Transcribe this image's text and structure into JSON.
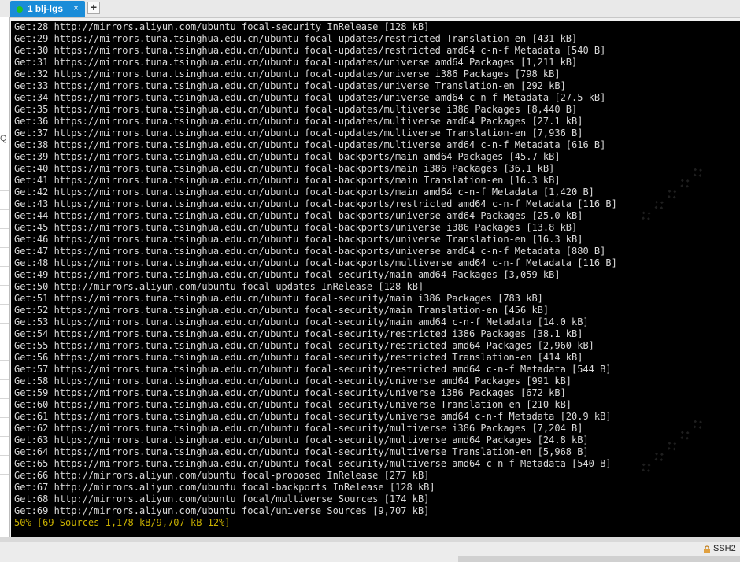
{
  "tab": {
    "number": "1",
    "name": "blj-lgs",
    "close": "×",
    "add": "+"
  },
  "sidebar": {
    "search_glyph": "Q"
  },
  "terminal": {
    "lines": [
      "Get:28 http://mirrors.aliyun.com/ubuntu focal-security InRelease [128 kB]",
      "Get:29 https://mirrors.tuna.tsinghua.edu.cn/ubuntu focal-updates/restricted Translation-en [431 kB]",
      "Get:30 https://mirrors.tuna.tsinghua.edu.cn/ubuntu focal-updates/restricted amd64 c-n-f Metadata [540 B]",
      "Get:31 https://mirrors.tuna.tsinghua.edu.cn/ubuntu focal-updates/universe amd64 Packages [1,211 kB]",
      "Get:32 https://mirrors.tuna.tsinghua.edu.cn/ubuntu focal-updates/universe i386 Packages [798 kB]",
      "Get:33 https://mirrors.tuna.tsinghua.edu.cn/ubuntu focal-updates/universe Translation-en [292 kB]",
      "Get:34 https://mirrors.tuna.tsinghua.edu.cn/ubuntu focal-updates/universe amd64 c-n-f Metadata [27.5 kB]",
      "Get:35 https://mirrors.tuna.tsinghua.edu.cn/ubuntu focal-updates/multiverse i386 Packages [8,440 B]",
      "Get:36 https://mirrors.tuna.tsinghua.edu.cn/ubuntu focal-updates/multiverse amd64 Packages [27.1 kB]",
      "Get:37 https://mirrors.tuna.tsinghua.edu.cn/ubuntu focal-updates/multiverse Translation-en [7,936 B]",
      "Get:38 https://mirrors.tuna.tsinghua.edu.cn/ubuntu focal-updates/multiverse amd64 c-n-f Metadata [616 B]",
      "Get:39 https://mirrors.tuna.tsinghua.edu.cn/ubuntu focal-backports/main amd64 Packages [45.7 kB]",
      "Get:40 https://mirrors.tuna.tsinghua.edu.cn/ubuntu focal-backports/main i386 Packages [36.1 kB]",
      "Get:41 https://mirrors.tuna.tsinghua.edu.cn/ubuntu focal-backports/main Translation-en [16.3 kB]",
      "Get:42 https://mirrors.tuna.tsinghua.edu.cn/ubuntu focal-backports/main amd64 c-n-f Metadata [1,420 B]",
      "Get:43 https://mirrors.tuna.tsinghua.edu.cn/ubuntu focal-backports/restricted amd64 c-n-f Metadata [116 B]",
      "Get:44 https://mirrors.tuna.tsinghua.edu.cn/ubuntu focal-backports/universe amd64 Packages [25.0 kB]",
      "Get:45 https://mirrors.tuna.tsinghua.edu.cn/ubuntu focal-backports/universe i386 Packages [13.8 kB]",
      "Get:46 https://mirrors.tuna.tsinghua.edu.cn/ubuntu focal-backports/universe Translation-en [16.3 kB]",
      "Get:47 https://mirrors.tuna.tsinghua.edu.cn/ubuntu focal-backports/universe amd64 c-n-f Metadata [880 B]",
      "Get:48 https://mirrors.tuna.tsinghua.edu.cn/ubuntu focal-backports/multiverse amd64 c-n-f Metadata [116 B]",
      "Get:49 https://mirrors.tuna.tsinghua.edu.cn/ubuntu focal-security/main amd64 Packages [3,059 kB]",
      "Get:50 http://mirrors.aliyun.com/ubuntu focal-updates InRelease [128 kB]",
      "Get:51 https://mirrors.tuna.tsinghua.edu.cn/ubuntu focal-security/main i386 Packages [783 kB]",
      "Get:52 https://mirrors.tuna.tsinghua.edu.cn/ubuntu focal-security/main Translation-en [456 kB]",
      "Get:53 https://mirrors.tuna.tsinghua.edu.cn/ubuntu focal-security/main amd64 c-n-f Metadata [14.0 kB]",
      "Get:54 https://mirrors.tuna.tsinghua.edu.cn/ubuntu focal-security/restricted i386 Packages [38.1 kB]",
      "Get:55 https://mirrors.tuna.tsinghua.edu.cn/ubuntu focal-security/restricted amd64 Packages [2,960 kB]",
      "Get:56 https://mirrors.tuna.tsinghua.edu.cn/ubuntu focal-security/restricted Translation-en [414 kB]",
      "Get:57 https://mirrors.tuna.tsinghua.edu.cn/ubuntu focal-security/restricted amd64 c-n-f Metadata [544 B]",
      "Get:58 https://mirrors.tuna.tsinghua.edu.cn/ubuntu focal-security/universe amd64 Packages [991 kB]",
      "Get:59 https://mirrors.tuna.tsinghua.edu.cn/ubuntu focal-security/universe i386 Packages [672 kB]",
      "Get:60 https://mirrors.tuna.tsinghua.edu.cn/ubuntu focal-security/universe Translation-en [210 kB]",
      "Get:61 https://mirrors.tuna.tsinghua.edu.cn/ubuntu focal-security/universe amd64 c-n-f Metadata [20.9 kB]",
      "Get:62 https://mirrors.tuna.tsinghua.edu.cn/ubuntu focal-security/multiverse i386 Packages [7,204 B]",
      "Get:63 https://mirrors.tuna.tsinghua.edu.cn/ubuntu focal-security/multiverse amd64 Packages [24.8 kB]",
      "Get:64 https://mirrors.tuna.tsinghua.edu.cn/ubuntu focal-security/multiverse Translation-en [5,968 B]",
      "Get:65 https://mirrors.tuna.tsinghua.edu.cn/ubuntu focal-security/multiverse amd64 c-n-f Metadata [540 B]",
      "Get:66 http://mirrors.aliyun.com/ubuntu focal-proposed InRelease [277 kB]",
      "Get:67 http://mirrors.aliyun.com/ubuntu focal-backports InRelease [128 kB]",
      "Get:68 http://mirrors.aliyun.com/ubuntu focal/multiverse Sources [174 kB]",
      "Get:69 http://mirrors.aliyun.com/ubuntu focal/universe Sources [9,707 kB]"
    ],
    "status_line": "50% [69 Sources 1,178 kB/9,707 kB 12%]"
  },
  "statusbar": {
    "protocol": "SSH2"
  },
  "colors": {
    "tab_active": "#1a8cd8",
    "connected_dot": "#22c322",
    "terminal_bg": "#000000",
    "terminal_fg": "#d9d9d9",
    "progress_text": "#c9b000"
  }
}
